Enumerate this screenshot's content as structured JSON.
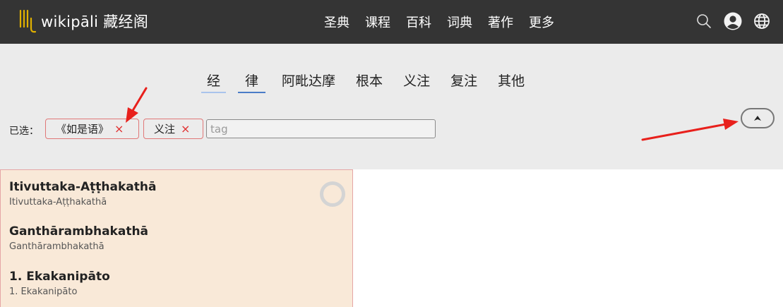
{
  "header": {
    "logo_text": "wikipāli 藏经阁",
    "nav": [
      "圣典",
      "课程",
      "百科",
      "词典",
      "著作",
      "更多"
    ],
    "icons": [
      "search-icon",
      "user-icon",
      "globe-icon"
    ]
  },
  "filters": {
    "tabs": [
      "经",
      "律",
      "阿毗达摩",
      "根本",
      "义注",
      "复注",
      "其他"
    ],
    "selected_label": "已选：",
    "tags": [
      {
        "label": "《如是语》",
        "remove": "×"
      },
      {
        "label": "义注",
        "remove": "×"
      }
    ],
    "tag_input_placeholder": "tag",
    "collapse_icon": "chevron-up-icon"
  },
  "results": [
    {
      "title": "Itivuttaka-Aṭṭhakathā",
      "subtitle": "Itivuttaka-Aṭṭhakathā"
    },
    {
      "title": "Ganthārambhakathā",
      "subtitle": "Ganthārambhakathā"
    },
    {
      "title": "1. Ekakanipāto",
      "subtitle": "1. Ekakanipāto"
    }
  ],
  "colors": {
    "header_bg": "#343434",
    "panel_bg": "#ebebeb",
    "result_bg": "#f9e9d8",
    "tag_border": "#e07878",
    "annotation_arrow": "#e8201c",
    "logo_accent": "#e0b000"
  }
}
